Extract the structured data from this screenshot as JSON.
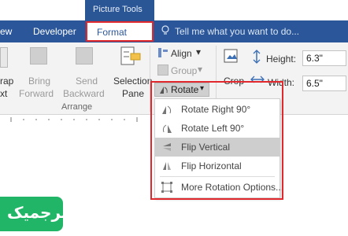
{
  "tabs": {
    "context_label": "Picture Tools",
    "view_partial": "ew",
    "developer": "Developer",
    "format": "Format",
    "tell_me": "Tell me what you want to do..."
  },
  "ribbon": {
    "wrap_text_1": "rap",
    "wrap_text_2": "xt",
    "bring_forward_1": "Bring",
    "bring_forward_2": "Forward",
    "send_backward_1": "Send",
    "send_backward_2": "Backward",
    "selection_pane_1": "Selection",
    "selection_pane_2": "Pane",
    "align": "Align",
    "group": "Group",
    "rotate": "Rotate",
    "crop": "Crop",
    "arrange_label": "Arrange",
    "height_label": "Height:",
    "height_value": "6.3\"",
    "width_label": "Width:",
    "width_value": "6.5\""
  },
  "rotate_menu": {
    "items": [
      {
        "label": "Rotate Right 90°",
        "icon": "rotate-right-icon"
      },
      {
        "label": "Rotate Left 90°",
        "icon": "rotate-left-icon"
      },
      {
        "label": "Flip Vertical",
        "icon": "flip-vertical-icon",
        "highlighted": true
      },
      {
        "label": "Flip Horizontal",
        "icon": "flip-horizontal-icon"
      },
      {
        "label": "More Rotation Options...",
        "icon": "more-rotation-options-icon"
      }
    ]
  },
  "logo": {
    "text": "ترجمیک"
  },
  "colors": {
    "title_blue": "#2b579a",
    "highlight_red": "#e0282d",
    "logo_green": "#21b567",
    "menu_highlight": "#cecece"
  }
}
